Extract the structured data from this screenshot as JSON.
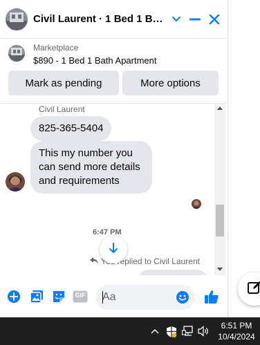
{
  "header": {
    "title": "Civil Laurent · 1 Bed 1 Bath…",
    "chevron_icon": "chevron-down-icon",
    "minimize_icon": "minimize-icon",
    "close_icon": "close-icon",
    "accent": "#0a7cff"
  },
  "marketplace": {
    "label": "Marketplace",
    "listing": "$890 - 1 Bed 1 Bath Apartment",
    "mark_pending_label": "Mark as pending",
    "more_options_label": "More options"
  },
  "messages": {
    "sender": "Civil Laurent",
    "bubble1": "825-365-5404",
    "bubble2_line1": "This my number you",
    "bubble2_line2": "can send more details",
    "bubble2_line3": "and requirements",
    "timestamp": "6:47 PM",
    "replied_text": "You replied to Civil Laurent"
  },
  "composer": {
    "placeholder": "Aa",
    "icons": [
      "plus-circle-icon",
      "photo-icon",
      "sticker-icon",
      "gif-icon",
      "emoji-icon",
      "thumbs-up-icon"
    ],
    "gif_label": "GIF"
  },
  "taskbar": {
    "time": "6:51 PM",
    "date": "10/4/2024",
    "icons": [
      "chevron-up-icon",
      "security-shield-icon",
      "network-icon",
      "volume-icon"
    ]
  }
}
